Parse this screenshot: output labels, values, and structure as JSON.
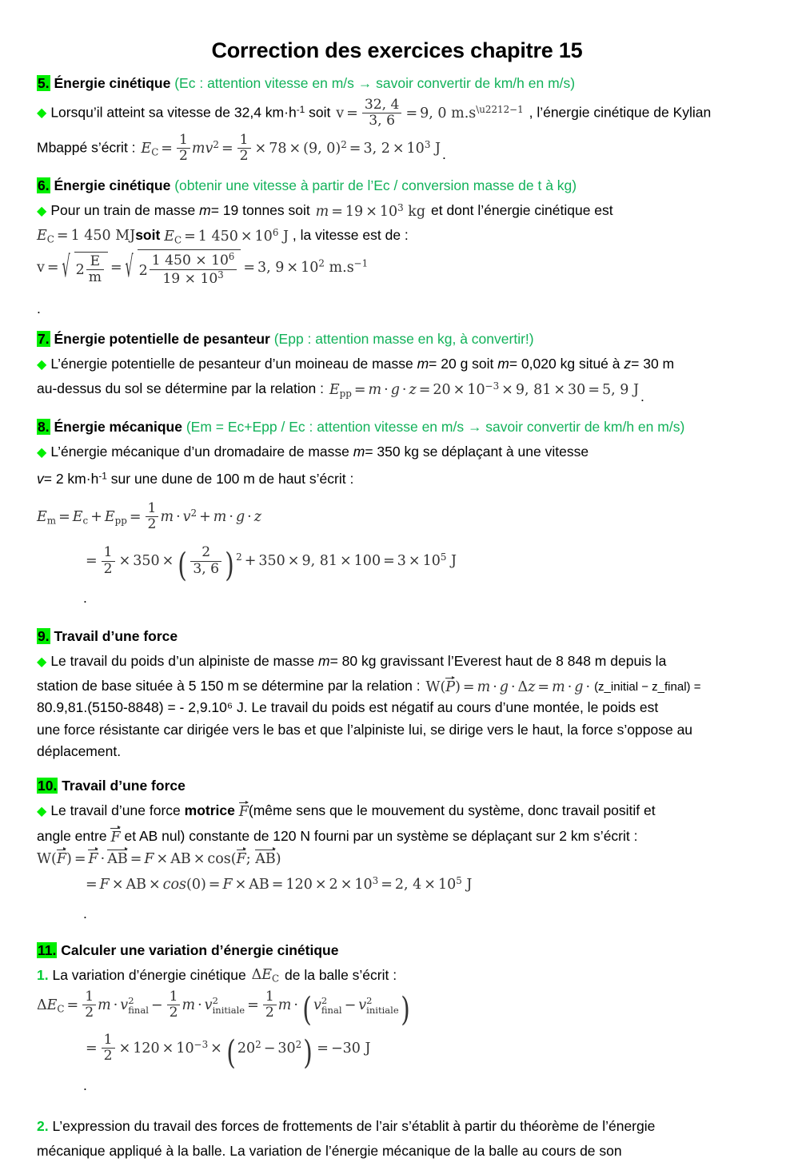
{
  "document": {
    "title": "Correction des exercices chapitre 15",
    "bullet_glyph": "◆",
    "colors": {
      "highlight_green": "#00ee00",
      "hint_green": "#12b25a",
      "bullet_green": "#00ee00",
      "math_gray": "#333333",
      "text_black": "#000000"
    }
  },
  "sections": [
    {
      "number": "5.",
      "title": "Énergie cinétique",
      "hint": "(Ec : attention vitesse en m/s → savoir convertir de km/h en m/s)",
      "body": {
        "lead_1": "Lorsqu’il atteint sa vitesse de 32,4 km·h",
        "lead_1_sup": "-1",
        "lead_1_tail": "soit",
        "formula_inline": "v = 32,4 / 3,6 = 9,0 m.s⁻¹",
        "after_formula": ", l’énergie cinétique de Kylian",
        "line_2": "Mbappé s’écrit :",
        "formula_2": "E_C = (1/2) m v² = (1/2) × 78 × (9,0)² = 3,2 × 10³ J",
        "values": {
          "vitesse_kmh": "32,4",
          "conversion_divisor": "3,6",
          "vitesse_ms": "9,0",
          "masse_kg": "78",
          "resultat": "3,2 × 10³ J"
        }
      }
    },
    {
      "number": "6.",
      "title": "Énergie cinétique",
      "hint": "(obtenir une vitesse à partir de l’Ec  /  conversion masse de t à  kg)",
      "body": {
        "lead_1": "Pour un train de masse",
        "var_m": "m",
        "masse_tonnes": "= 19 tonnes soit",
        "formula_masse": "m = 19 × 10³ kg",
        "lead_1_tail": "et dont l’énergie cinétique est",
        "formula_ec_mj": "E_C = 1 450 MJ",
        "soit": "soit",
        "formula_ec_j": "E_C = 1 450 × 10⁶ J",
        "after": ", la vitesse est de :",
        "formula_v": "v = √(2 E_C/m) = √(2 × 1 450 × 10⁶ / 19 × 10³) = 3,9 × 10² m.s⁻¹",
        "values": {
          "masse_t": "19",
          "masse_kg": "19 × 10³",
          "ec_mj": "1 450",
          "ec_j": "1 450 × 10⁶",
          "resultat": "3,9 × 10² m.s⁻¹"
        }
      }
    },
    {
      "number": "7.",
      "title": "Énergie potentielle de pesanteur",
      "hint": "(Epp : attention masse en kg,  à convertir!)",
      "body": {
        "line_1_a": "L’énergie potentielle de pesanteur d’un moineau de masse",
        "line_1_m1": "m",
        "line_1_b": "= 20 g soit",
        "line_1_m2": "m",
        "line_1_c": "= 0,020 kg situé à",
        "line_1_z": "z",
        "line_1_d": "= 30 m",
        "line_2": "au-dessus du sol se détermine par la relation :",
        "formula": "E_pp = m · g · z = 20 × 10⁻³ × 9,81 × 30 = 5,9 J",
        "values": {
          "masse_g": "20",
          "masse_kg": "0,020",
          "hauteur_m": "30",
          "g": "9,81",
          "resultat": "5,9 J"
        }
      }
    },
    {
      "number": "8.",
      "title": "Énergie mécanique",
      "hint": "(Em = Ec+Epp / Ec : attention vitesse en m/s → savoir convertir de km/h en m/s)",
      "body": {
        "line_1_a": "L’énergie mécanique d’un dromadaire de masse",
        "line_1_m": "m",
        "line_1_b": "= 350 kg se déplaçant à une vitesse",
        "line_2_v": "v",
        "line_2_a": "= 2 km·h",
        "line_2_sup": "-1",
        "line_2_b": "sur une dune de 100 m de haut s’écrit :",
        "formula_1": "E_m = E_c + E_pp = (1/2) m · v² + m · g · z",
        "formula_2": "= (1/2) × 350 × (2/3,6)² + 350 × 9,81 × 100 = 3 × 10⁵ J",
        "values": {
          "masse_kg": "350",
          "vitesse_kmh": "2",
          "hauteur_m": "100",
          "g": "9,81",
          "resultat": "3 × 10⁵ J"
        }
      }
    },
    {
      "number": "9.",
      "title": "Travail d’une force",
      "hint": "",
      "body": {
        "line_1_a": "Le travail du poids d’un alpiniste de masse",
        "line_1_m": "m",
        "line_1_b": "= 80 kg gravissant l’Everest haut de 8 848 m depuis la",
        "line_2_a": "station de base située à 5 150 m se détermine par la relation :",
        "formula": "W(P⃗) = m · g · Δz = m · g ·",
        "subscripts": "(z_initial − z_final) =",
        "line_3": "80.9,81.(5150-8848) = - 2,9.10⁶ J. Le travail du poids est négatif au cours d’une montée, le poids est",
        "line_4": "une force résistante car dirigée vers le bas et que l’alpiniste lui, se dirige vers le haut, la force s’oppose au",
        "line_5": "déplacement.",
        "values": {
          "masse_kg": "80",
          "altitude_sommet": "8 848",
          "altitude_base": "5 150",
          "g": "9,81",
          "resultat": "- 2,9.10⁶ J"
        }
      }
    },
    {
      "number": "10.",
      "title": "Travail d’une force",
      "hint": "",
      "body": {
        "line_1_a": "Le travail d’une force",
        "line_1_bold": "motrice",
        "line_1_vecF": "F",
        "line_1_b": "(même sens que le mouvement du système, donc travail positif et",
        "line_2_a": "angle entre",
        "line_2_vecF": "F",
        "line_2_b": "et AB nul) constante de 120 N fourni par un système se déplaçant sur 2 km s’écrit :",
        "formula_1": "W(F⃗) = F⃗ · AB⃗ = F × AB × cos(F⃗; AB⃗)",
        "formula_2": "= F × AB × cos(0) = F × AB = 120 × 2 × 10³ = 2,4 × 10⁵ J",
        "values": {
          "force_N": "120",
          "distance_km": "2",
          "distance_m": "2 × 10³",
          "resultat": "2,4 × 10⁵ J"
        }
      }
    },
    {
      "number": "11.",
      "title": "Calculer une variation d’énergie cinétique",
      "hint": "",
      "body": {
        "q1_num": "1.",
        "q1_a": "La variation d’énergie cinétique",
        "q1_math": "ΔE_C",
        "q1_b": "de la balle s’écrit :",
        "formula_1": "ΔE_C = (1/2) m · v²_final − (1/2) m · v²_initiale = (1/2) m · (v²_final − v²_initiale)",
        "formula_2": "= (1/2) × 120 × 10⁻³ × (20² − 30²) = −30 J",
        "q2_num": "2.",
        "q2_line_1": "L’expression du travail des forces de frottements de l’air s’établit à partir du théorème de l’énergie",
        "q2_line_2": "mécanique appliqué à la balle. La variation de l’énergie mécanique de la balle au cours de son",
        "values": {
          "masse_g": "120",
          "masse_kg": "120 × 10⁻³",
          "v_final": "20",
          "v_initiale": "30",
          "resultat": "−30 J"
        }
      }
    }
  ]
}
